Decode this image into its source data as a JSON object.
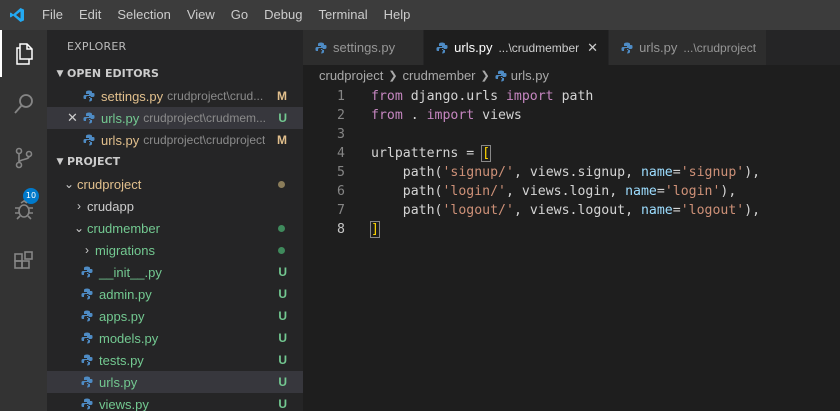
{
  "menubar": {
    "items": [
      "File",
      "Edit",
      "Selection",
      "View",
      "Go",
      "Debug",
      "Terminal",
      "Help"
    ]
  },
  "activitybar": {
    "icons": [
      "files-icon",
      "search-icon",
      "source-control-icon",
      "debug-icon",
      "extensions-icon"
    ],
    "source_control_badge": "10"
  },
  "sidebar": {
    "title": "EXPLORER",
    "open_editors": {
      "header": "OPEN EDITORS",
      "items": [
        {
          "name": "settings.py",
          "path": "crudproject\\crud...",
          "status": "M"
        },
        {
          "name": "urls.py",
          "path": "crudproject\\crudmem...",
          "status": "U"
        },
        {
          "name": "urls.py",
          "path": "crudproject\\crudproject",
          "status": "M"
        }
      ]
    },
    "project": {
      "header": "PROJECT",
      "tree": [
        {
          "name": "crudproject"
        },
        {
          "name": "crudapp"
        },
        {
          "name": "crudmember"
        },
        {
          "name": "migrations"
        },
        {
          "name": "__init__.py",
          "status": "U"
        },
        {
          "name": "admin.py",
          "status": "U"
        },
        {
          "name": "apps.py",
          "status": "U"
        },
        {
          "name": "models.py",
          "status": "U"
        },
        {
          "name": "tests.py",
          "status": "U"
        },
        {
          "name": "urls.py",
          "status": "U"
        },
        {
          "name": "views.py",
          "status": "U"
        }
      ]
    }
  },
  "tabs": [
    {
      "name": "settings.py",
      "desc": ""
    },
    {
      "name": "urls.py",
      "desc": "...\\crudmember"
    },
    {
      "name": "urls.py",
      "desc": "...\\crudproject"
    }
  ],
  "breadcrumb": [
    "crudproject",
    "crudmember",
    "urls.py"
  ],
  "code": {
    "line_numbers": [
      "1",
      "2",
      "3",
      "4",
      "5",
      "6",
      "7",
      "8"
    ],
    "tokens": {
      "l1": [
        "from",
        " django.urls ",
        "import",
        " path"
      ],
      "l2": [
        "from",
        " . ",
        "import",
        " views"
      ],
      "l4": [
        "urlpatterns = ",
        "["
      ],
      "l5": [
        "    path(",
        "'signup/'",
        ", views.signup, ",
        "name",
        "=",
        "'signup'",
        "),"
      ],
      "l6": [
        "    path(",
        "'login/'",
        ", views.login, ",
        "name",
        "=",
        "'login'",
        "),"
      ],
      "l7": [
        "    path(",
        "'logout/'",
        ", views.logout, ",
        "name",
        "=",
        "'logout'",
        "),"
      ],
      "l8": [
        "]"
      ]
    }
  }
}
